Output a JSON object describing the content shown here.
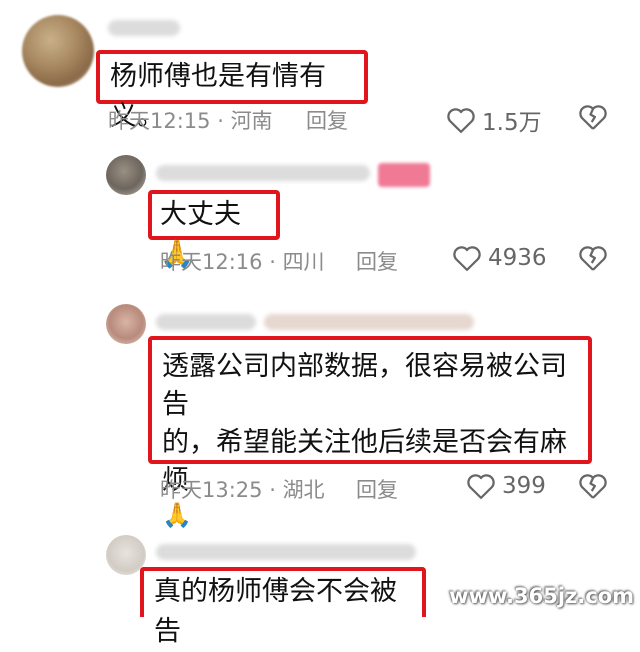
{
  "comments": [
    {
      "text": "杨师傅也是有情有义。",
      "time": "昨天12:15",
      "location": "河南",
      "reply": "回复",
      "likes": "1.5万",
      "emoji": ""
    },
    {
      "text": "大丈夫",
      "time": "昨天12:16",
      "location": "四川",
      "reply": "回复",
      "likes": "4936",
      "emoji": "🙏"
    },
    {
      "text_line1": "透露公司内部数据，很容易被公司告",
      "text_line2": "的，希望能关注他后续是否会有麻烦",
      "time": "昨天13:25",
      "location": "湖北",
      "reply": "回复",
      "likes": "399",
      "emoji": "🙏"
    },
    {
      "text": "真的杨师傅会不会被告"
    }
  ],
  "separator": " · ",
  "icons": {
    "like": "heart-outline-icon",
    "dislike": "broken-heart-icon"
  },
  "watermark": "www.365jz.com",
  "colors": {
    "highlight_border": "#e0161c",
    "meta": "#8b8b8b"
  }
}
